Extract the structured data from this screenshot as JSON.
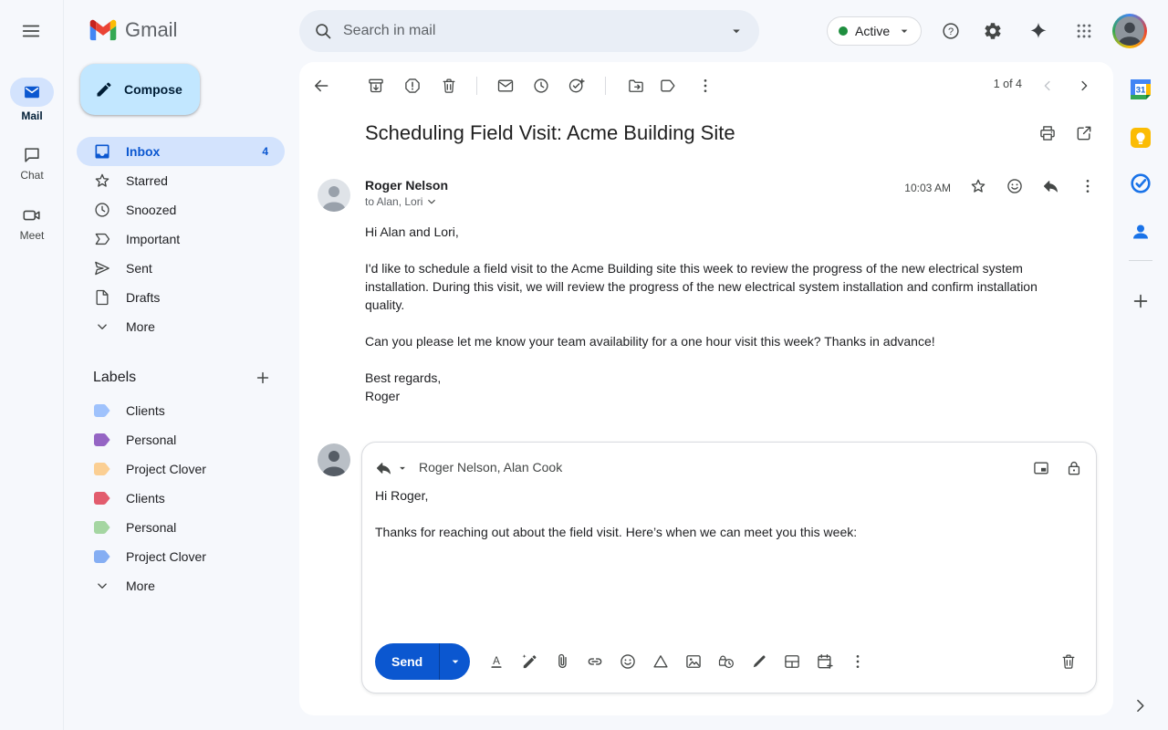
{
  "colors": {
    "accent_blue": "#0b57d0",
    "compose_bg": "#c2e7ff",
    "selected_pill": "#d3e3fd",
    "active_dot": "#1e8e3e",
    "send_bg": "#0b57d0"
  },
  "topbar": {
    "product_name": "Gmail",
    "search_placeholder": "Search in mail",
    "status_label": "Active"
  },
  "rail": {
    "mail_label": "Mail",
    "chat_label": "Chat",
    "meet_label": "Meet"
  },
  "sidebar": {
    "compose_label": "Compose",
    "items": [
      {
        "label": "Inbox",
        "count": "4"
      },
      {
        "label": "Starred"
      },
      {
        "label": "Snoozed"
      },
      {
        "label": "Important"
      },
      {
        "label": "Sent"
      },
      {
        "label": "Drafts"
      },
      {
        "label": "More"
      }
    ],
    "labels_header": "Labels",
    "labels": [
      {
        "name": "Clients",
        "color": "#9fc2fc"
      },
      {
        "name": "Personal",
        "color": "#9565c4"
      },
      {
        "name": "Project Clover",
        "color": "#fbcf93"
      },
      {
        "name": "Clients",
        "color": "#e25c6d"
      },
      {
        "name": "Personal",
        "color": "#a5d6a2"
      },
      {
        "name": "Project Clover",
        "color": "#85aef3"
      },
      {
        "name": "More"
      }
    ]
  },
  "thread": {
    "pagination": "1 of 4",
    "subject": "Scheduling Field Visit: Acme Building Site",
    "message": {
      "sender": "Roger Nelson",
      "recipients_line": "to Alan, Lori",
      "time": "10:03 AM",
      "paragraphs": [
        "Hi Alan and Lori,",
        "I'd like to schedule a field visit to the Acme Building site this week to review the progress of the new electrical system installation. During this visit, we will review the progress of the new electrical system installation and confirm installation quality.",
        "Can you please let me know your team availability for a one hour visit this week? Thanks in advance!"
      ],
      "signoff": "Best regards,",
      "signature": "Roger"
    },
    "reply": {
      "recipients": "Roger Nelson, Alan Cook",
      "paragraphs": [
        "Hi Roger,",
        "Thanks for reaching out about the field visit. Here’s when we can meet you this week:"
      ],
      "send_label": "Send"
    }
  }
}
